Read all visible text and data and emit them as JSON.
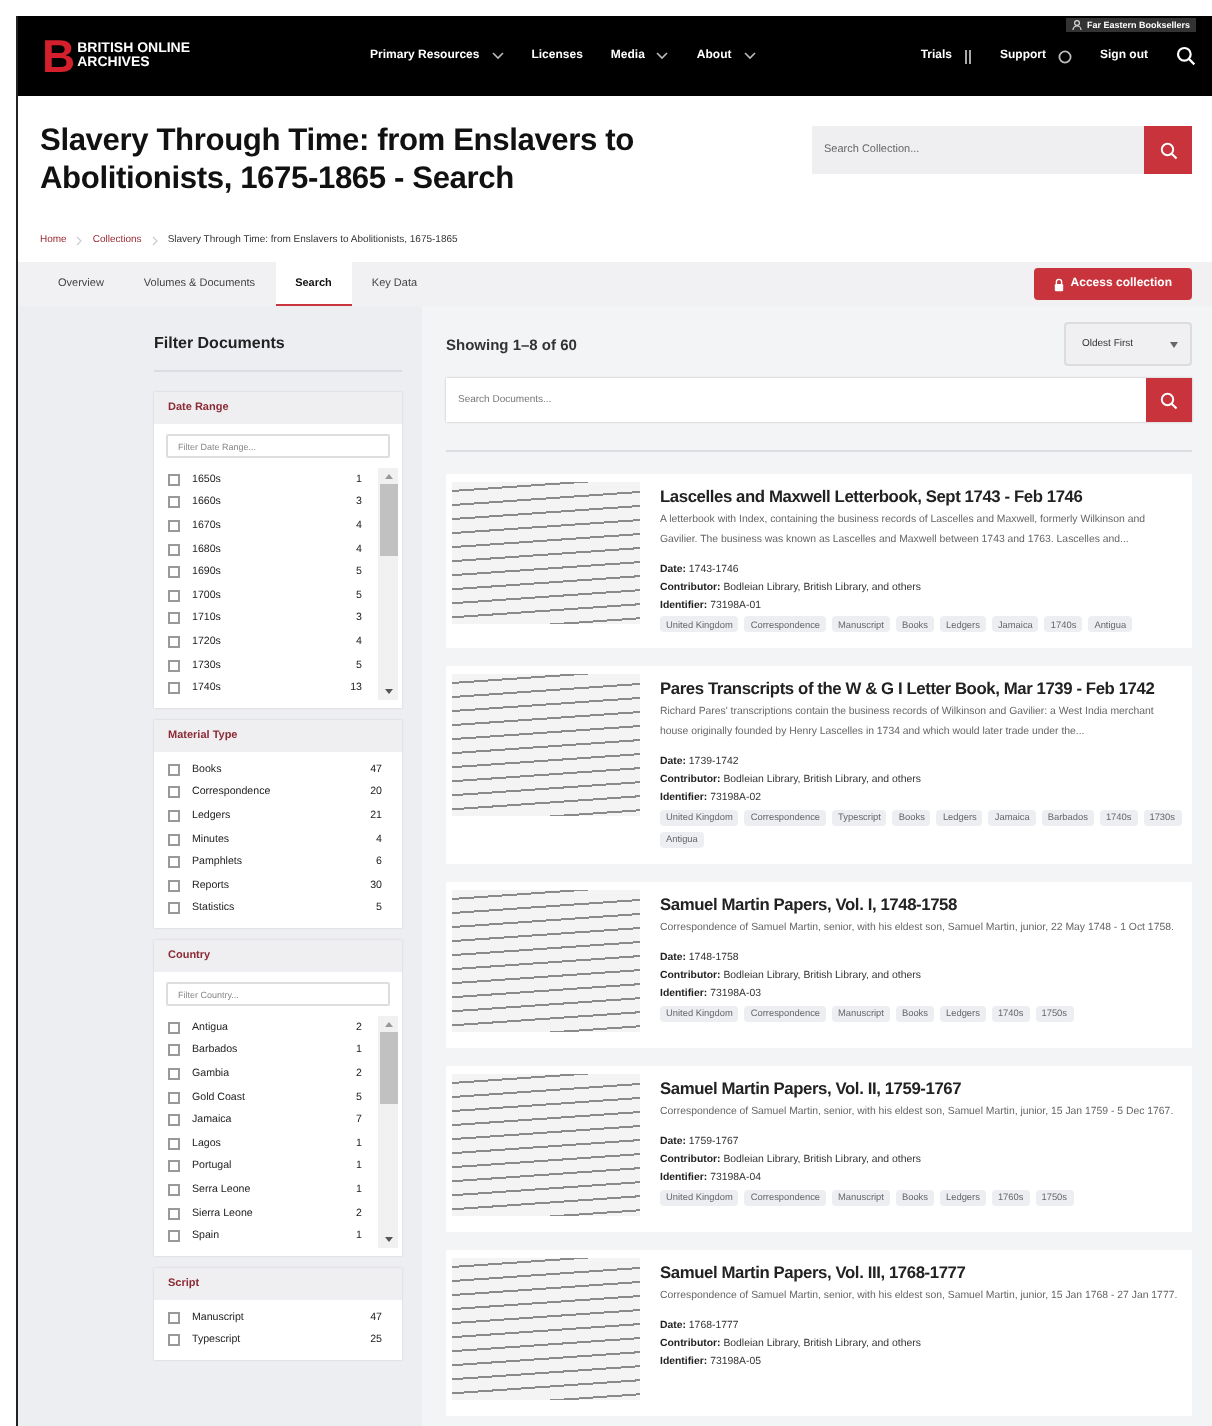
{
  "header": {
    "logo_mark": "B",
    "logo_lines": [
      "BRITISH ONLINE",
      "ARCHIVES"
    ],
    "account": "Far Eastern Booksellers",
    "nav": [
      {
        "label": "Primary Resources",
        "dropdown": true
      },
      {
        "label": "Licenses",
        "dropdown": false
      },
      {
        "label": "Media",
        "dropdown": true
      },
      {
        "label": "About",
        "dropdown": true
      }
    ],
    "utility": [
      {
        "label": "Trials",
        "kind": "trials"
      },
      {
        "label": "Support",
        "kind": "support"
      },
      {
        "label": "Sign out",
        "kind": "plain"
      }
    ]
  },
  "page": {
    "title": "Slavery Through Time: from Enslavers to Abolitionists, 1675-1865 - Search",
    "search_placeholder": "Search Collection...",
    "breadcrumbs": [
      "Home",
      "Collections",
      "Slavery Through Time: from Enslavers to Abolitionists, 1675-1865"
    ]
  },
  "tabs": [
    {
      "label": "Overview",
      "selected": false
    },
    {
      "label": "Volumes & Documents",
      "selected": false
    },
    {
      "label": "Search",
      "selected": true
    },
    {
      "label": "Key Data",
      "selected": false
    }
  ],
  "access_button": "Access collection",
  "filters": {
    "title": "Filter Documents",
    "groups": [
      {
        "title": "Date Range",
        "placeholder": "Filter Date Range...",
        "scrollable": true,
        "items": [
          {
            "label": "1650s",
            "count": "1",
            "checked": false
          },
          {
            "label": "1660s",
            "count": "3",
            "checked": false
          },
          {
            "label": "1670s",
            "count": "4",
            "checked": false
          },
          {
            "label": "1680s",
            "count": "4",
            "checked": false
          },
          {
            "label": "1690s",
            "count": "5",
            "checked": false
          },
          {
            "label": "1700s",
            "count": "5",
            "checked": false
          },
          {
            "label": "1710s",
            "count": "3",
            "checked": false
          },
          {
            "label": "1720s",
            "count": "4",
            "checked": false
          },
          {
            "label": "1730s",
            "count": "5",
            "checked": false
          },
          {
            "label": "1740s",
            "count": "13",
            "checked": false
          }
        ]
      },
      {
        "title": "Material Type",
        "scrollable": false,
        "items": [
          {
            "label": "Books",
            "count": "47",
            "checked": false
          },
          {
            "label": "Correspondence",
            "count": "20",
            "checked": false
          },
          {
            "label": "Ledgers",
            "count": "21",
            "checked": false
          },
          {
            "label": "Minutes",
            "count": "4",
            "checked": false
          },
          {
            "label": "Pamphlets",
            "count": "6",
            "checked": false
          },
          {
            "label": "Reports",
            "count": "30",
            "checked": false
          },
          {
            "label": "Statistics",
            "count": "5",
            "checked": false
          }
        ]
      },
      {
        "title": "Country",
        "placeholder": "Filter Country...",
        "scrollable": true,
        "items": [
          {
            "label": "Antigua",
            "count": "2",
            "checked": false
          },
          {
            "label": "Barbados",
            "count": "1",
            "checked": false
          },
          {
            "label": "Gambia",
            "count": "2",
            "checked": false
          },
          {
            "label": "Gold Coast",
            "count": "5",
            "checked": false
          },
          {
            "label": "Jamaica",
            "count": "7",
            "checked": false
          },
          {
            "label": "Lagos",
            "count": "1",
            "checked": false
          },
          {
            "label": "Portugal",
            "count": "1",
            "checked": false
          },
          {
            "label": "Serra Leone",
            "count": "1",
            "checked": false
          },
          {
            "label": "Sierra Leone",
            "count": "2",
            "checked": false
          },
          {
            "label": "Spain",
            "count": "1",
            "checked": false
          }
        ]
      },
      {
        "title": "Script",
        "scrollable": false,
        "items": [
          {
            "label": "Manuscript",
            "count": "47",
            "checked": false
          },
          {
            "label": "Typescript",
            "count": "25",
            "checked": false
          }
        ]
      }
    ]
  },
  "results": {
    "showing": "Showing 1–8 of 60",
    "sort": "Oldest First",
    "search_placeholder": "Search Documents...",
    "cards": [
      {
        "title": "Lascelles and Maxwell Letterbook, Sept 1743 - Feb 1746",
        "description": "A letterbook with Index, containing the business records of Lascelles and Maxwell, formerly Wilkinson and Gavilier. The business was known as Lascelles and Maxwell between 1743 and 1763. Lascelles and...",
        "fields": [
          "**Date:** 1743-1746",
          "**Contributor:** Bodleian Library, British Library, and others",
          "**Identifier:** 73198A-01"
        ],
        "tags": [
          "United Kingdom",
          "Correspondence",
          "Manuscript",
          "Books",
          "Ledgers",
          "Jamaica",
          "1740s",
          "Antigua"
        ]
      },
      {
        "title": "Pares Transcripts of the W & G I Letter Book, Mar 1739 - Feb 1742",
        "description": "Richard Pares' transcriptions contain the business records of Wilkinson and Gavilier: a West India merchant house originally founded by Henry Lascelles in 1734 and which would later trade under the...",
        "fields": [
          "**Date:** 1739-1742",
          "**Contributor:** Bodleian Library, British Library, and others",
          "**Identifier:** 73198A-02"
        ],
        "tags": [
          "United Kingdom",
          "Correspondence",
          "Typescript",
          "Books",
          "Ledgers",
          "Jamaica",
          "Barbados",
          "1740s",
          "1730s",
          "Antigua"
        ]
      },
      {
        "title": "Samuel Martin Papers, Vol. I, 1748-1758",
        "description": "Correspondence of Samuel Martin, senior, with his eldest son, Samuel Martin, junior, 22 May 1748 - 1 Oct 1758.",
        "fields": [
          "**Date:** 1748-1758",
          "**Contributor:** Bodleian Library, British Library, and others",
          "**Identifier:** 73198A-03"
        ],
        "tags": [
          "United Kingdom",
          "Correspondence",
          "Manuscript",
          "Books",
          "Ledgers",
          "1740s",
          "1750s"
        ]
      },
      {
        "title": "Samuel Martin Papers, Vol. II, 1759-1767",
        "description": "Correspondence of Samuel Martin, senior, with his eldest son, Samuel Martin, junior, 15 Jan 1759 - 5 Dec 1767.",
        "fields": [
          "**Date:** 1759-1767",
          "**Contributor:** Bodleian Library, British Library, and others",
          "**Identifier:** 73198A-04"
        ],
        "tags": [
          "United Kingdom",
          "Correspondence",
          "Manuscript",
          "Books",
          "Ledgers",
          "1760s",
          "1750s"
        ]
      },
      {
        "title": "Samuel Martin Papers, Vol. III, 1768-1777",
        "description": "Correspondence of Samuel Martin, senior, with his eldest son, Samuel Martin, junior, 15 Jan 1768 - 27 Jan 1777.",
        "fields": [
          "**Date:** 1768-1777",
          "**Contributor:** Bodleian Library, British Library, and others",
          "**Identifier:** 73198A-05"
        ]
      }
    ]
  }
}
